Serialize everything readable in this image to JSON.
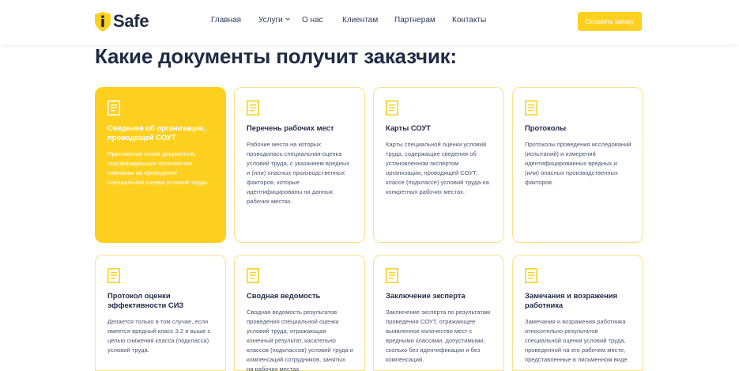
{
  "header": {
    "logo_letter": "i",
    "logo_text": "Safe",
    "nav": [
      "Главная",
      "Услуги",
      "О нас",
      "Клиентам",
      "Партнерам",
      "Контакты"
    ],
    "cta_label": "Оставить заявку"
  },
  "section_title": "Какие документы получит заказчик:",
  "cards": [
    {
      "title": "Сведения об организации, проводящей СОУТ",
      "text": "Приложения копий документов, подтверждающих полномочия компании на проведение специальной оценки условий труда.",
      "active": true
    },
    {
      "title": "Перечень рабочих мест",
      "text": "Рабочие места на которых проводилась специальная оценка условий труда, с указанием вредных и (или) опасных производственных факторов, которые идентифицированы на данных рабочих местах."
    },
    {
      "title": "Карты СОУТ",
      "text": "Карты специальной оценки условий труда, содержащие сведения об установленном экспертом организации, проводящей СОУТ, классе (подклассе) условий труда на конкретных рабочих местах."
    },
    {
      "title": "Протоколы",
      "text": "Протоколы проведения исследований (испытаний) и измерений идентифицированных вредных и (или) опасных производственных факторов."
    },
    {
      "title": "Протокол оценки эффективности СИЗ",
      "text": "Делается только в том случае, если имеется вредный класс 3.2 и выше с целью снижения класса (подкласса) условий труда."
    },
    {
      "title": "Сводная ведомость",
      "text": "Сводная ведомость результатов проведения специальной оценки условий труда, отражающая конечный результат, касательно классов (подклассов) условий труда и компенсаций сотрудников, занятых на рабочих местах."
    },
    {
      "title": "Заключение эксперта",
      "text": "Заключение эксперта по результатам проведения СОУТ, отражающее выявленное количество мест с вредными классами, допустимыми, сколько без идентификации и без компенсаций."
    },
    {
      "title": "Замечания и возражения работника",
      "text": "Замечания и возражения работника относительно результатов специальной оценки условий труда, проведенной на его рабочем месте, представленные в письменном виде."
    }
  ],
  "colors": {
    "accent": "#fdd020",
    "text_dark": "#1f2a44",
    "card_border": "#fbe08a"
  },
  "icons": {
    "logo": "shield-icon",
    "card": "document-icon",
    "dropdown": "chevron-down-icon"
  }
}
